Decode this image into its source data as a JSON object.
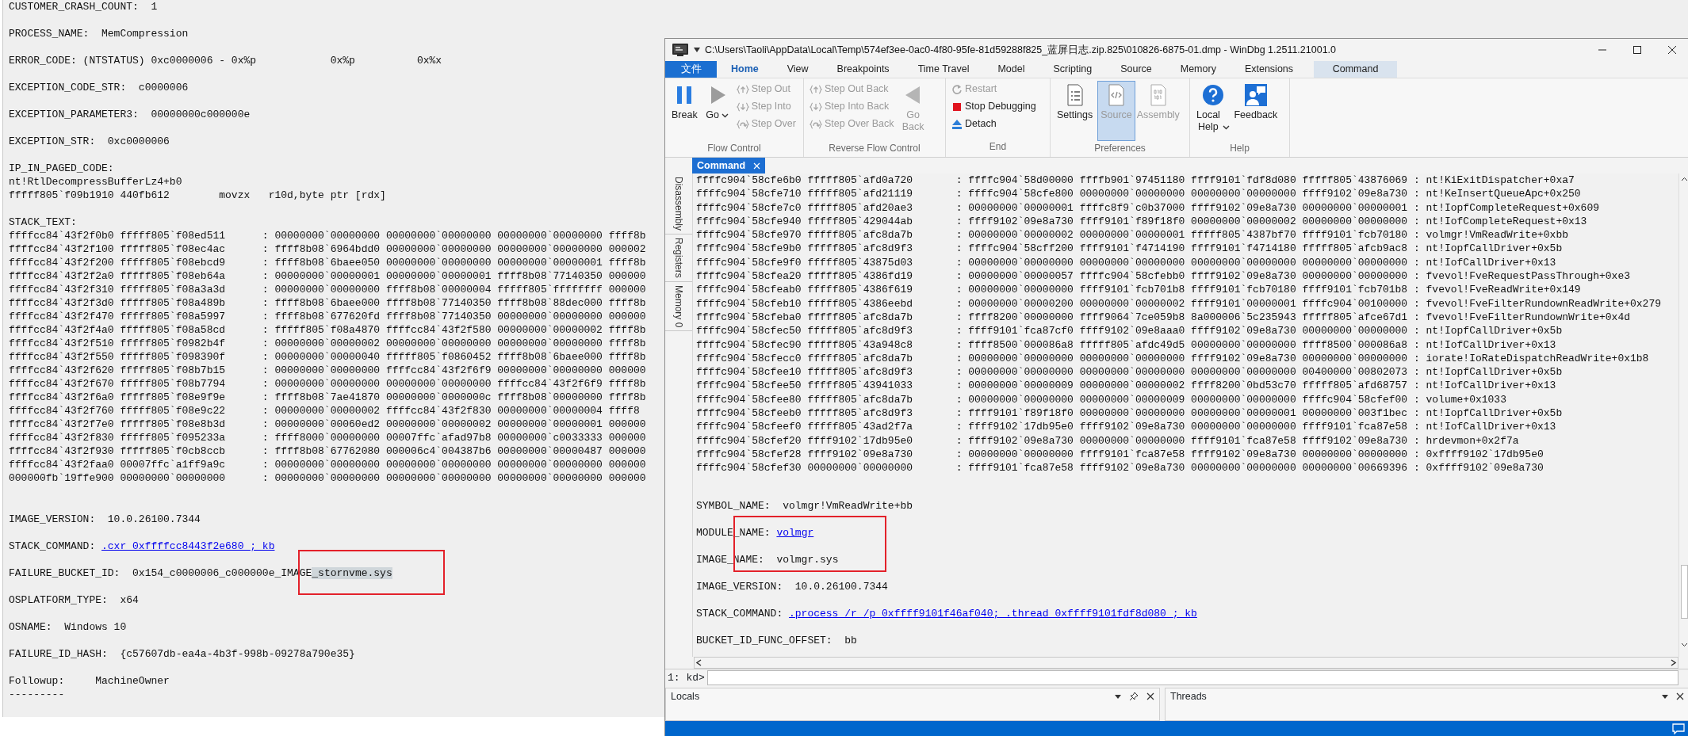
{
  "analysis_output": {
    "blocks": [
      {
        "kind": "line",
        "text": "CUSTOMER_CRASH_COUNT:  1"
      },
      {
        "kind": "line",
        "text": "PROCESS_NAME:  MemCompression"
      },
      {
        "kind": "line",
        "text": "ERROR_CODE: (NTSTATUS) 0xc0000006 - 0x%p            0x%p          0x%x"
      },
      {
        "kind": "line",
        "text": "EXCEPTION_CODE_STR:  c0000006"
      },
      {
        "kind": "line",
        "text": "EXCEPTION_PARAMETER3:  00000000c000000e"
      },
      {
        "kind": "line",
        "text": "EXCEPTION_STR:  0xc0000006"
      },
      {
        "kind": "lines",
        "texts": [
          "IP_IN_PAGED_CODE:",
          "nt!RtlDecompressBufferLz4+b0",
          "fffff805`f09b1910 440fb612        movzx   r10d,byte ptr [rdx]"
        ]
      },
      {
        "kind": "stack",
        "title": "STACK_TEXT:",
        "rows": [
          "ffffcc84`43f2f0b0 fffff805`f08ed511      : 00000000`00000000 00000000`00000000 00000000`00000000 ffff8b",
          "ffffcc84`43f2f100 fffff805`f08ec4ac      : ffff8b08`6964bdd0 00000000`00000000 00000000`00000000 000002",
          "ffffcc84`43f2f200 fffff805`f08ebcd9      : ffff8b08`6baee050 00000000`00000000 00000000`00000001 ffff8b",
          "ffffcc84`43f2f2a0 fffff805`f08eb64a      : 00000000`00000001 00000000`00000001 ffff8b08`77140350 000000",
          "ffffcc84`43f2f310 fffff805`f08a3a3d      : 00000000`00000000 ffff8b08`00000004 fffff805`ffffffff 000000",
          "ffffcc84`43f2f3d0 fffff805`f08a489b      : ffff8b08`6baee000 ffff8b08`77140350 ffff8b08`88dec000 ffff8b",
          "ffffcc84`43f2f470 fffff805`f08a5997      : ffff8b08`677620fd ffff8b08`77140350 00000000`00000000 000000",
          "ffffcc84`43f2f4a0 fffff805`f08a58cd      : fffff805`f08a4870 ffffcc84`43f2f580 00000000`00000002 ffff8b",
          "ffffcc84`43f2f510 fffff805`f0982b4f      : 00000000`00000002 00000000`00000000 00000000`00000000 ffff8b",
          "ffffcc84`43f2f550 fffff805`f098390f      : 00000000`00000040 fffff805`f0860452 ffff8b08`6baee000 ffff8b",
          "ffffcc84`43f2f620 fffff805`f08b7b15      : 00000000`00000000 ffffcc84`43f2f6f9 00000000`00000000 000000",
          "ffffcc84`43f2f670 fffff805`f08b7794      : 00000000`00000000 00000000`00000000 ffffcc84`43f2f6f9 ffff8b",
          "ffffcc84`43f2f6a0 fffff805`f08e9f9e      : ffff8b08`7ae41870 00000000`0000000c ffff8b08`00000000 ffff8b",
          "ffffcc84`43f2f760 fffff805`f08e9c22      : 00000000`00000002 ffffcc84`43f2f830 00000000`00000004 ffff8",
          "ffffcc84`43f2f7e0 fffff805`f08e8b3d      : 00000000`00060ed2 00000000`00000002 00000000`00000001 000000",
          "ffffcc84`43f2f830 fffff805`f095233a      : ffff8000`00000000 00007ffc`afad97b8 00000000`c0033333 000000",
          "ffffcc84`43f2f930 fffff805`f0cb8ccb      : ffff8b08`67762080 000006c4`004387b6 00000000`00000487 000000",
          "ffffcc84`43f2faa0 00007ffc`a1ff9a9c      : 00000000`00000000 00000000`00000000 00000000`00000000 000000",
          "000000fb`19ffe900 00000000`00000000      : 00000000`00000000 00000000`00000000 00000000`00000000 000000"
        ]
      },
      {
        "kind": "line",
        "text": "IMAGE_VERSION:  10.0.26100.7344"
      },
      {
        "kind": "link_field",
        "label": "STACK_COMMAND:",
        "link": ".cxr 0xffffcc8443f2e680 ; kb"
      },
      {
        "kind": "selection_field",
        "label": "FAILURE_BUCKET_ID:",
        "parts": [
          {
            "text": "0x154_c0000006_c000000e_IMAGE",
            "selected": false
          },
          {
            "text": "_stornvme.sys",
            "selected": true
          }
        ]
      },
      {
        "kind": "line",
        "text": "OSPLATFORM_TYPE:  x64"
      },
      {
        "kind": "line",
        "text": "OSNAME:  Windows 10"
      },
      {
        "kind": "line",
        "text": "FAILURE_ID_HASH:  {c57607db-ea4a-4b3f-998b-09278a790e35}"
      },
      {
        "kind": "lines",
        "texts": [
          "Followup:     MachineOwner",
          "---------"
        ]
      }
    ]
  },
  "windbg": {
    "title": "C:\\Users\\Taoli\\AppData\\Local\\Temp\\574ef3ee-0ac0-4f80-95fe-81d59288f825_蓝屏日志.zip.825\\010826-6875-01.dmp - WinDbg 1.2511.21001.0",
    "ribbon_tabs": [
      {
        "label": "文件",
        "kind": "file",
        "selected": false
      },
      {
        "label": "Home",
        "kind": "plain",
        "selected": true
      },
      {
        "label": "View",
        "kind": "plain",
        "selected": false
      },
      {
        "label": "Breakpoints",
        "kind": "plain",
        "selected": false
      },
      {
        "label": "Time Travel",
        "kind": "plain",
        "selected": false
      },
      {
        "label": "Model",
        "kind": "plain",
        "selected": false
      },
      {
        "label": "Scripting",
        "kind": "plain",
        "selected": false
      },
      {
        "label": "Source",
        "kind": "plain",
        "selected": false
      },
      {
        "label": "Memory",
        "kind": "plain",
        "selected": false
      },
      {
        "label": "Extensions",
        "kind": "plain",
        "selected": false
      },
      {
        "label": "Command",
        "kind": "contextual",
        "selected": false
      }
    ],
    "ribbon_groups": [
      {
        "label": "Flow Control",
        "items": [
          {
            "label": "Break",
            "kind": "large",
            "disabled": false,
            "pressed": false,
            "dropdown": false
          },
          {
            "label": "Go",
            "kind": "large",
            "disabled": false,
            "pressed": false,
            "dropdown": true
          },
          {
            "label": "Step Out",
            "kind": "small",
            "disabled": true,
            "pressed": false,
            "dropdown": false
          },
          {
            "label": "Step Into",
            "kind": "small",
            "disabled": true,
            "pressed": false,
            "dropdown": false
          },
          {
            "label": "Step Over",
            "kind": "small",
            "disabled": true,
            "pressed": false,
            "dropdown": false
          }
        ]
      },
      {
        "label": "Reverse Flow Control",
        "items": [
          {
            "label": "Step Out Back",
            "kind": "small",
            "disabled": true,
            "pressed": false,
            "dropdown": false
          },
          {
            "label": "Step Into Back",
            "kind": "small",
            "disabled": true,
            "pressed": false,
            "dropdown": false
          },
          {
            "label": "Step Over Back",
            "kind": "small",
            "disabled": true,
            "pressed": false,
            "dropdown": false
          },
          {
            "label": "Go Back",
            "kind": "large",
            "disabled": true,
            "pressed": false,
            "dropdown": false
          }
        ]
      },
      {
        "label": "End",
        "items": [
          {
            "label": "Restart",
            "kind": "small",
            "disabled": true,
            "pressed": false,
            "dropdown": false
          },
          {
            "label": "Stop Debugging",
            "kind": "small",
            "disabled": false,
            "pressed": false,
            "dropdown": false
          },
          {
            "label": "Detach",
            "kind": "small",
            "disabled": false,
            "pressed": false,
            "dropdown": false
          }
        ]
      },
      {
        "label": "Preferences",
        "items": [
          {
            "label": "Settings",
            "kind": "large",
            "disabled": false,
            "pressed": false,
            "dropdown": false
          },
          {
            "label": "Source",
            "kind": "large",
            "disabled": true,
            "pressed": true,
            "dropdown": false
          },
          {
            "label": "Assembly",
            "kind": "large",
            "disabled": true,
            "pressed": false,
            "dropdown": false
          }
        ]
      },
      {
        "label": "Help",
        "items": [
          {
            "label": "Local Help",
            "kind": "large",
            "disabled": false,
            "pressed": false,
            "dropdown": true
          },
          {
            "label": "Feedback",
            "kind": "large",
            "disabled": false,
            "pressed": false,
            "dropdown": false
          }
        ]
      }
    ],
    "document_tab": {
      "label": "Command",
      "selected": true
    },
    "side_tabs": [
      "Disassembly",
      "Registers",
      "Memory 0"
    ],
    "output_blocks": [
      {
        "kind": "stack",
        "rows": [
          "ffffc904`58cfe6b0 fffff805`afd0a720       : ffffc904`58d00000 ffffb901`97451180 ffff9101`fdf8d080 fffff805`43876069 : nt!KiExitDispatcher+0xa7",
          "ffffc904`58cfe710 fffff805`afd21119       : ffffc904`58cfe800 00000000`00000000 00000000`00000000 ffff9102`09e8a730 : nt!KeInsertQueueApc+0x250",
          "ffffc904`58cfe7c0 fffff805`afd20ae3       : 00000000`00000001 ffffc8f9`c0b37000 ffff9102`09e8a730 00000000`00000001 : nt!IopfCompleteRequest+0x609",
          "ffffc904`58cfe940 fffff805`429044ab       : ffff9102`09e8a730 ffff9101`f89f18f0 00000000`00000002 00000000`00000000 : nt!IofCompleteRequest+0x13",
          "ffffc904`58cfe970 fffff805`afc8da7b       : 00000000`00000002 00000000`00000001 fffff805`4387bf70 ffff9101`fcb70180 : volmgr!VmReadWrite+0xbb",
          "ffffc904`58cfe9b0 fffff805`afc8d9f3       : ffffc904`58cff200 ffff9101`f4714190 ffff9101`f4714180 fffff805`afcb9ac8 : nt!IopfCallDriver+0x5b",
          "ffffc904`58cfe9f0 fffff805`43875d03       : 00000000`00000000 00000000`00000000 00000000`00000000 00000000`00000000 : nt!IofCallDriver+0x13",
          "ffffc904`58cfea20 fffff805`4386fd19       : 00000000`00000057 ffffc904`58cfebb0 ffff9102`09e8a730 00000000`00000000 : fvevol!FveRequestPassThrough+0xe3",
          "ffffc904`58cfeab0 fffff805`4386f619       : 00000000`00000000 ffff9101`fcb701b8 ffff9101`fcb70180 ffff9101`fcb701b8 : fvevol!FveReadWrite+0x149",
          "ffffc904`58cfeb10 fffff805`4386eebd       : 00000000`00000200 00000000`00000002 ffff9101`00000001 ffffc904`00100000 : fvevol!FveFilterRundownReadWrite+0x279",
          "ffffc904`58cfeba0 fffff805`afc8da7b       : ffff8200`00000000 ffff9064`7ce059b8 8a000006`5c235943 fffff805`afce67d1 : fvevol!FveFilterRundownWrite+0x4d",
          "ffffc904`58cfec50 fffff805`afc8d9f3       : ffff9101`fca87cf0 ffff9102`09e8aaa0 ffff9102`09e8a730 00000000`00000000 : nt!IopfCallDriver+0x5b",
          "ffffc904`58cfec90 fffff805`43a948c8       : ffff8500`000086a8 fffff805`afdc49d5 00000000`00000000 ffff8500`000086a8 : nt!IofCallDriver+0x13",
          "ffffc904`58cfecc0 fffff805`afc8da7b       : 00000000`00000000 00000000`00000000 ffff9102`09e8a730 00000000`00000000 : iorate!IoRateDispatchReadWrite+0x1b8",
          "ffffc904`58cfee10 fffff805`afc8d9f3       : 00000000`00000000 00000000`00000000 00000000`00000000 00400000`00802073 : nt!IopfCallDriver+0x5b",
          "ffffc904`58cfee50 fffff805`43941033       : 00000000`00000009 00000000`00000002 ffff8200`0bd53c70 fffff805`afd68757 : nt!IofCallDriver+0x13",
          "ffffc904`58cfee80 fffff805`afc8da7b       : 00000000`00000000 00000000`00000009 00000000`00000000 ffffc904`58cfef00 : volume+0x1033",
          "ffffc904`58cfeeb0 fffff805`afc8d9f3       : ffff9101`f89f18f0 00000000`00000000 00000000`00000001 00000000`003f1bec : nt!IopfCallDriver+0x5b",
          "ffffc904`58cfeef0 fffff805`43ad2f7a       : ffff9102`17db95e0 ffff9102`09e8a730 00000000`00000000 ffff9101`fca87e58 : nt!IofCallDriver+0x13",
          "ffffc904`58cfef20 ffff9102`17db95e0       : ffff9102`09e8a730 00000000`00000000 ffff9101`fca87e58 ffff9102`09e8a730 : hrdevmon+0x2f7a",
          "ffffc904`58cfef28 ffff9102`09e8a730       : 00000000`00000000 ffff9101`fca87e58 ffff9102`09e8a730 00000000`00000000 : 0xffff9102`17db95e0",
          "ffffc904`58cfef30 00000000`00000000       : ffff9101`fca87e58 ffff9102`09e8a730 00000000`00000000 00000000`00669396 : 0xffff9102`09e8a730"
        ]
      },
      {
        "kind": "line",
        "text": "SYMBOL_NAME:  volmgr!VmReadWrite+bb"
      },
      {
        "kind": "link_field",
        "label": "MODULE_NAME:",
        "link": "volmgr"
      },
      {
        "kind": "line",
        "text": "IMAGE_NAME:  volmgr.sys"
      },
      {
        "kind": "line",
        "text": "IMAGE_VERSION:  10.0.26100.7344"
      },
      {
        "kind": "link_field",
        "label": "STACK_COMMAND:",
        "link": ".process /r /p 0xffff9101f46af040; .thread 0xffff9101fdf8d080 ; kb"
      },
      {
        "kind": "line",
        "text": "BUCKET_ID_FUNC_OFFSET:  bb"
      }
    ],
    "prompt": "1: kd>",
    "panels": [
      {
        "title": "Locals",
        "pinnable": true
      },
      {
        "title": "Threads",
        "pinnable": false
      }
    ]
  }
}
